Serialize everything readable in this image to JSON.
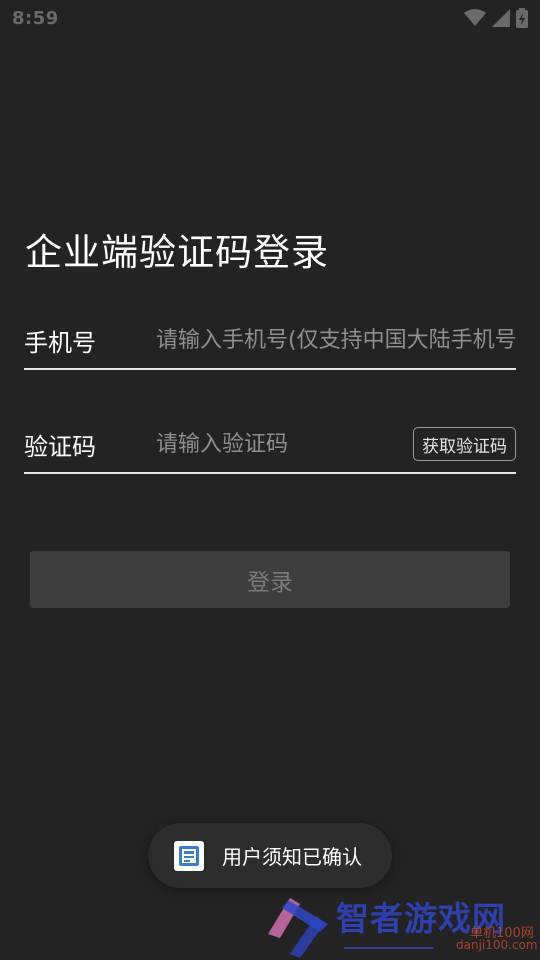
{
  "status_bar": {
    "time": "8:59",
    "icons": [
      "wifi-icon",
      "signal-icon",
      "battery-icon"
    ]
  },
  "page": {
    "title": "企业端验证码登录"
  },
  "phone_field": {
    "label": "手机号",
    "placeholder": "请输入手机号(仅支持中国大陆手机号)",
    "value": ""
  },
  "code_field": {
    "label": "验证码",
    "placeholder": "请输入验证码",
    "value": "",
    "get_code_label": "获取验证码"
  },
  "login_button": {
    "label": "登录",
    "enabled": false
  },
  "toast": {
    "icon": "app-icon",
    "text": "用户须知已确认"
  },
  "watermark": {
    "title": "智者游戏网",
    "sub": "单机100网",
    "sub2": "danji100.com"
  },
  "colors": {
    "background": "#232323",
    "button_disabled": "#3d3d3d",
    "divider": "#e6e6e6",
    "placeholder": "#8f8f8f"
  }
}
